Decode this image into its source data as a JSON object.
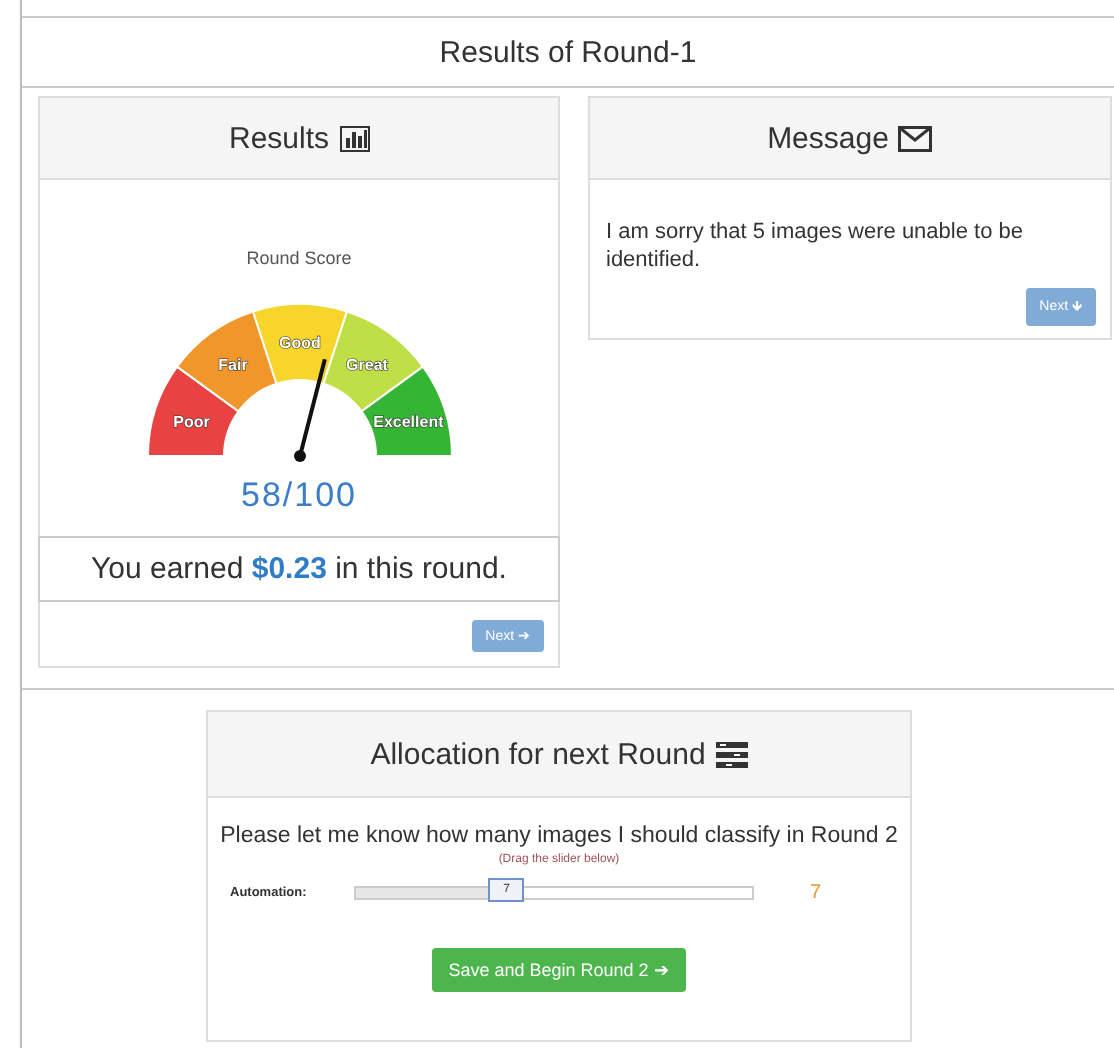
{
  "page_title": "Results of Round-1",
  "results": {
    "title": "Results",
    "gauge": {
      "title": "Round Score",
      "score": "58/100",
      "segments": [
        {
          "label": "Poor",
          "color": "#e84242"
        },
        {
          "label": "Fair",
          "color": "#f0962a"
        },
        {
          "label": "Good",
          "color": "#f7d52a"
        },
        {
          "label": "Great",
          "color": "#bedf45"
        },
        {
          "label": "Excellent",
          "color": "#35b534"
        }
      ]
    },
    "earned": "You earned **$0.23** in this round.",
    "button": "Next ➔"
  },
  "message": {
    "title": "Message",
    "text": "I am sorry that 5 images were unable to be identified.",
    "button": "Next 🡻"
  },
  "allocation": {
    "title": "Allocation for next Round",
    "prompt": "Please let me know how many images I should classify in Round 2",
    "hint": "(Drag the slider below)",
    "slider": {
      "label": "Automation:",
      "thumb": "7",
      "level": 0.38,
      "reading": "7"
    },
    "button": "Save and Begin Round 2 ➔"
  }
}
